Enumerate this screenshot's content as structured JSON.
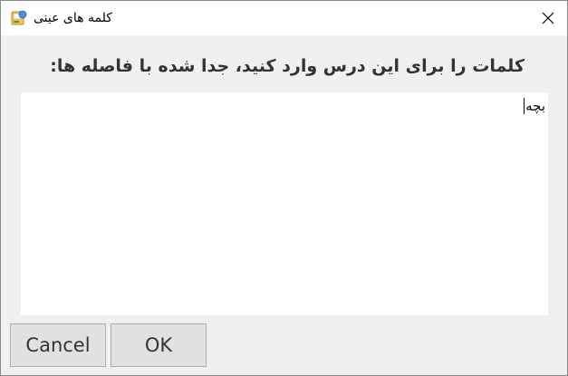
{
  "window": {
    "title": "کلمه های عینی",
    "icon": "app-icon"
  },
  "prompt": "کلمات را برای این درس وارد کنید، جدا شده با فاصله ها:",
  "textarea": {
    "value": "بچه"
  },
  "buttons": {
    "cancel_label": "Cancel",
    "ok_label": "OK"
  }
}
